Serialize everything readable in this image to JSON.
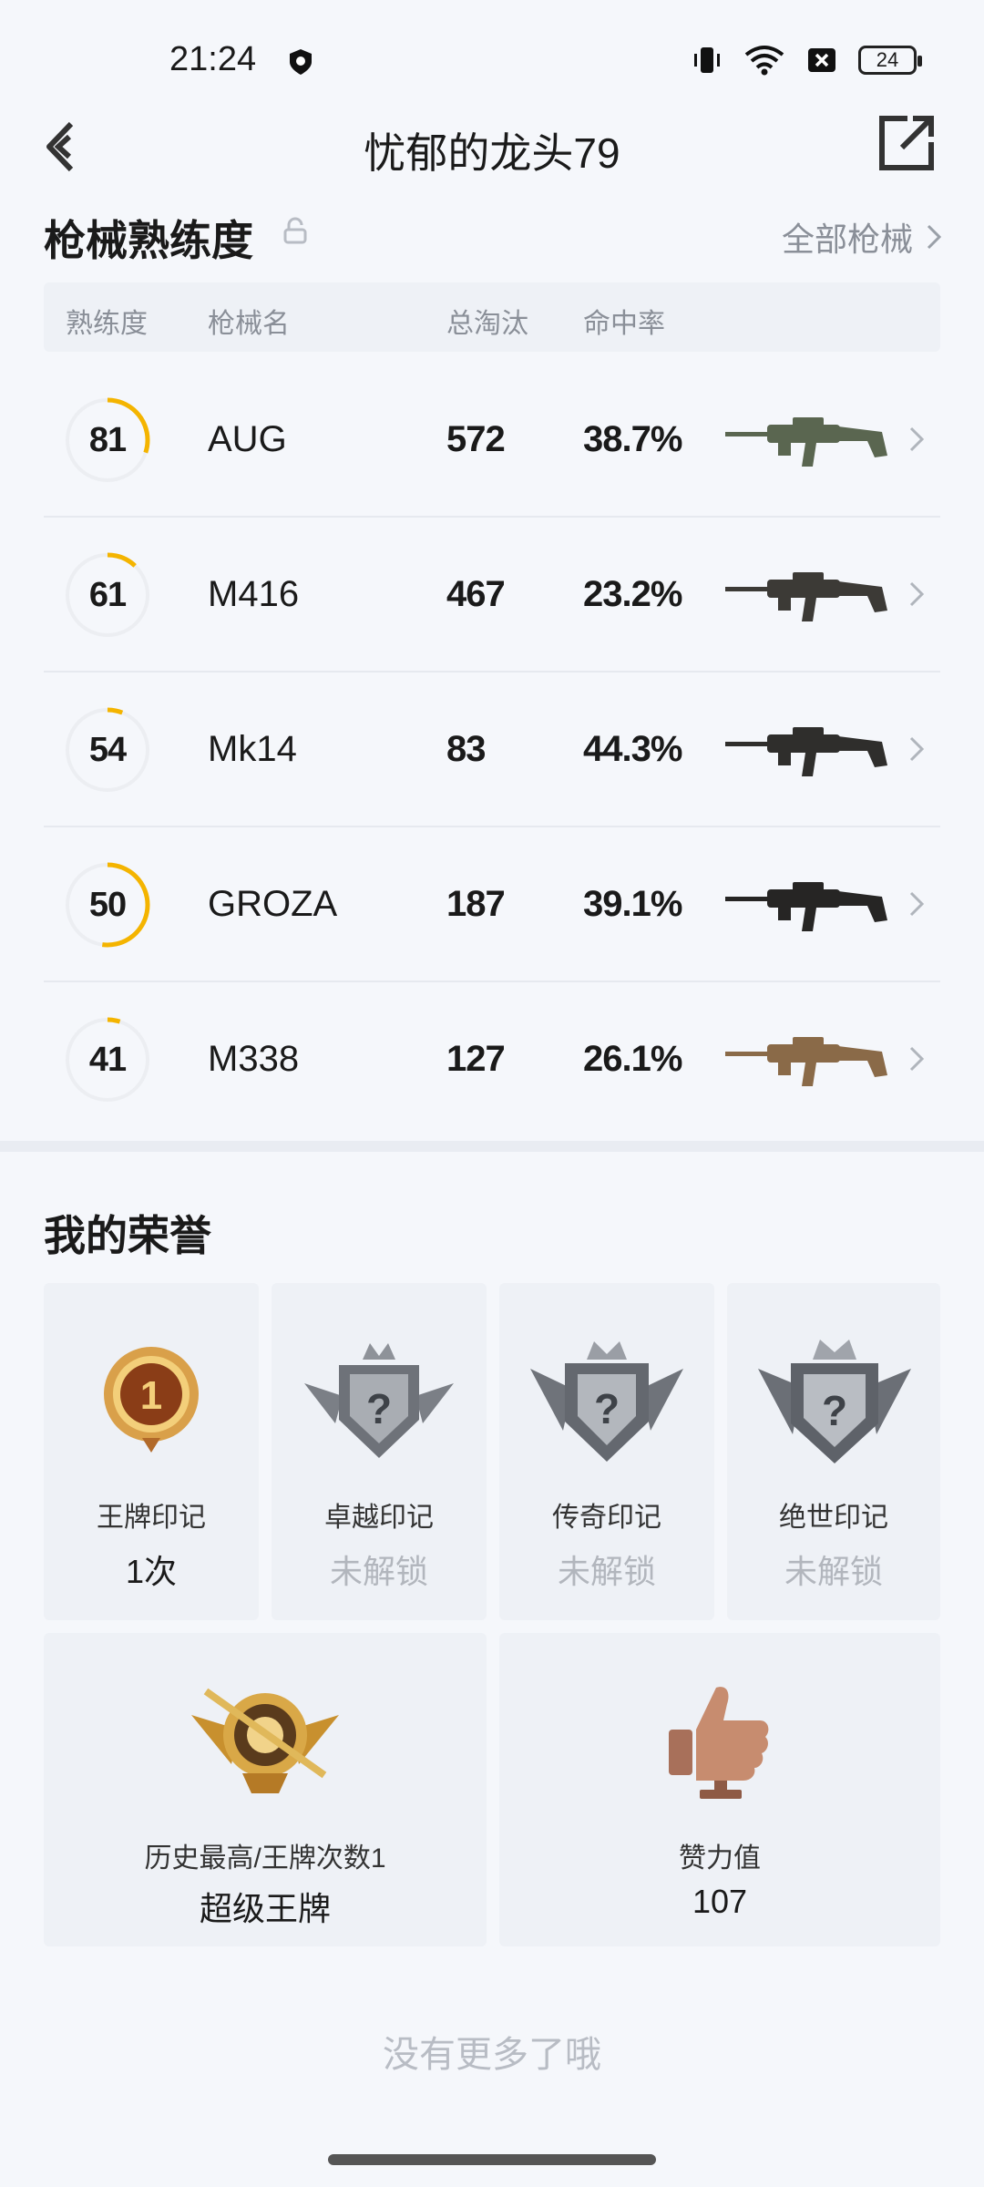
{
  "status": {
    "time": "21:24",
    "battery": "24"
  },
  "header": {
    "title": "忧郁的龙头79"
  },
  "weapons": {
    "section_title": "枪械熟练度",
    "all_label": "全部枪械",
    "columns": [
      "熟练度",
      "枪械名",
      "总淘汰",
      "命中率"
    ],
    "rows": [
      {
        "level": "81",
        "level_progress": 0.3,
        "name": "AUG",
        "kills": "572",
        "accuracy": "38.7%",
        "gun_color": "#5a6650"
      },
      {
        "level": "61",
        "level_progress": 0.12,
        "name": "M416",
        "kills": "467",
        "accuracy": "23.2%",
        "gun_color": "#3c3a36"
      },
      {
        "level": "54",
        "level_progress": 0.06,
        "name": "Mk14",
        "kills": "83",
        "accuracy": "44.3%",
        "gun_color": "#2f2e2c"
      },
      {
        "level": "50",
        "level_progress": 0.52,
        "name": "GROZA",
        "kills": "187",
        "accuracy": "39.1%",
        "gun_color": "#262524"
      },
      {
        "level": "41",
        "level_progress": 0.05,
        "name": "M338",
        "kills": "127",
        "accuracy": "26.1%",
        "gun_color": "#8a6a48"
      }
    ]
  },
  "honors": {
    "section_title": "我的荣誉",
    "cards": [
      {
        "label": "王牌印记",
        "value": "1次",
        "locked": false,
        "icon": "ace-medal-icon"
      },
      {
        "label": "卓越印记",
        "value": "未解锁",
        "locked": true,
        "icon": "excellence-badge-icon"
      },
      {
        "label": "传奇印记",
        "value": "未解锁",
        "locked": true,
        "icon": "legend-badge-icon"
      },
      {
        "label": "绝世印记",
        "value": "未解锁",
        "locked": true,
        "icon": "peerless-badge-icon"
      }
    ],
    "wide_cards": [
      {
        "label": "历史最高/王牌次数1",
        "value": "超级王牌",
        "icon": "super-ace-emblem-icon"
      },
      {
        "label": "赞力值",
        "value": "107",
        "icon": "thumbs-up-trophy-icon"
      }
    ]
  },
  "footer": {
    "no_more": "没有更多了哦"
  },
  "colors": {
    "accent": "#f4b400",
    "ring_track": "#eceef2",
    "background": "#f5f7fb"
  }
}
